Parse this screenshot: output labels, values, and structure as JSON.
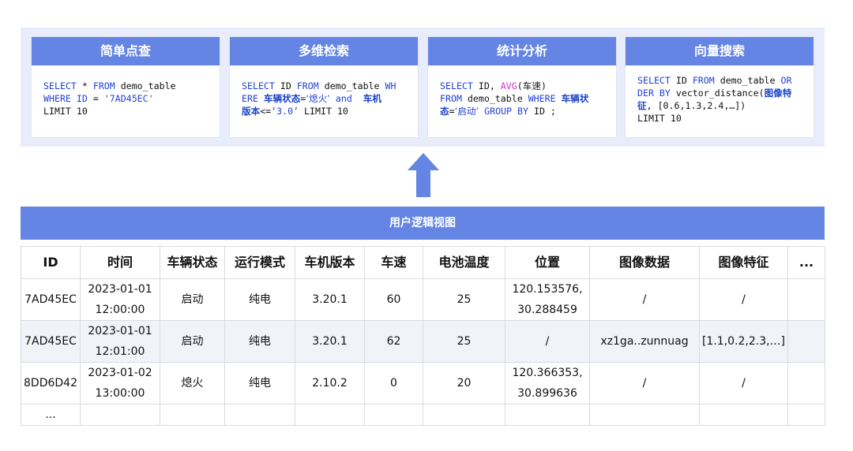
{
  "cards": [
    {
      "title": "简单点查",
      "lines": [
        [
          [
            "kw",
            "SELECT"
          ],
          [
            "p",
            " * "
          ],
          [
            "kw",
            "FROM"
          ],
          [
            "p",
            " demo_table"
          ]
        ],
        [
          [
            "kw",
            "WHERE ID"
          ],
          [
            "p",
            " = "
          ],
          [
            "str",
            "'7AD45EC'"
          ]
        ],
        [
          [
            "p",
            "LIMIT 10"
          ]
        ]
      ]
    },
    {
      "title": "多维检索",
      "lines": [
        [
          [
            "kw",
            "SELECT"
          ],
          [
            "p",
            " ID "
          ],
          [
            "kw",
            "FROM"
          ],
          [
            "p",
            " demo_table "
          ],
          [
            "kw",
            "WH"
          ]
        ],
        [
          [
            "kw",
            "ERE"
          ],
          [
            "p",
            " "
          ],
          [
            "cn",
            "车辆状态"
          ],
          [
            "p",
            "="
          ],
          [
            "cnv",
            "‘熄火’"
          ],
          [
            "p",
            " "
          ],
          [
            "kw",
            "and"
          ],
          [
            "p",
            "  "
          ],
          [
            "cn",
            "车机"
          ]
        ],
        [
          [
            "cn",
            "版本"
          ],
          [
            "p",
            "<="
          ],
          [
            "str",
            "‘3.0’"
          ],
          [
            "p",
            " LIMIT 10"
          ]
        ]
      ]
    },
    {
      "title": "统计分析",
      "lines": [
        [
          [
            "kw",
            "SELECT"
          ],
          [
            "p",
            " ID, "
          ],
          [
            "fn",
            "AVG"
          ],
          [
            "p",
            "("
          ],
          [
            "cnp",
            "车速"
          ],
          [
            "p",
            ")"
          ]
        ],
        [
          [
            "kw",
            "FROM"
          ],
          [
            "p",
            " demo_table "
          ],
          [
            "kw",
            "WHERE"
          ],
          [
            "p",
            " "
          ],
          [
            "cn",
            "车辆状"
          ]
        ],
        [
          [
            "cn",
            "态"
          ],
          [
            "p",
            "="
          ],
          [
            "cnv",
            "‘启动’"
          ],
          [
            "p",
            " "
          ],
          [
            "kw",
            "GROUP BY"
          ],
          [
            "p",
            " ID ;"
          ]
        ]
      ]
    },
    {
      "title": "向量搜索",
      "lines": [
        [
          [
            "kw",
            "SELECT"
          ],
          [
            "p",
            " ID "
          ],
          [
            "kw",
            "FROM"
          ],
          [
            "p",
            " demo_table "
          ],
          [
            "kw",
            "OR"
          ]
        ],
        [
          [
            "kw",
            "DER BY"
          ],
          [
            "p",
            " vector_distance("
          ],
          [
            "cn",
            "图像特"
          ]
        ],
        [
          [
            "cn",
            "征"
          ],
          [
            "p",
            ", [0.6,1.3,2.4,…])"
          ]
        ],
        [
          [
            "p",
            "LIMIT 10"
          ]
        ]
      ]
    }
  ],
  "view_bar_label": "用户逻辑视图",
  "table": {
    "headers": [
      "ID",
      "时间",
      "车辆状态",
      "运行模式",
      "车机版本",
      "车速",
      "电池温度",
      "位置",
      "图像数据",
      "图像特征",
      "..."
    ],
    "rows": [
      [
        "7AD45EC",
        "2023-01-01\n12:00:00",
        "启动",
        "纯电",
        "3.20.1",
        "60",
        "25",
        "120.153576,\n30.288459",
        "/",
        "/",
        ""
      ],
      [
        "7AD45EC",
        "2023-01-01\n12:01:00",
        "启动",
        "纯电",
        "3.20.1",
        "62",
        "25",
        "/",
        "xz1ga..zunnuag",
        "[1.1,0.2,2.3,…]",
        ""
      ],
      [
        "8DD6D42",
        "2023-01-02\n13:00:00",
        "熄火",
        "纯电",
        "2.10.2",
        "0",
        "20",
        "120.366353,\n30.899636",
        "/",
        "/",
        ""
      ]
    ],
    "ellipsis_row": "..."
  },
  "colors": {
    "accent": "#6585e4",
    "panel_bg": "#e9edfb",
    "keyword": "#1f3fd6",
    "function": "#d42fd0"
  },
  "icons": {
    "arrow": "arrow-up-icon"
  }
}
